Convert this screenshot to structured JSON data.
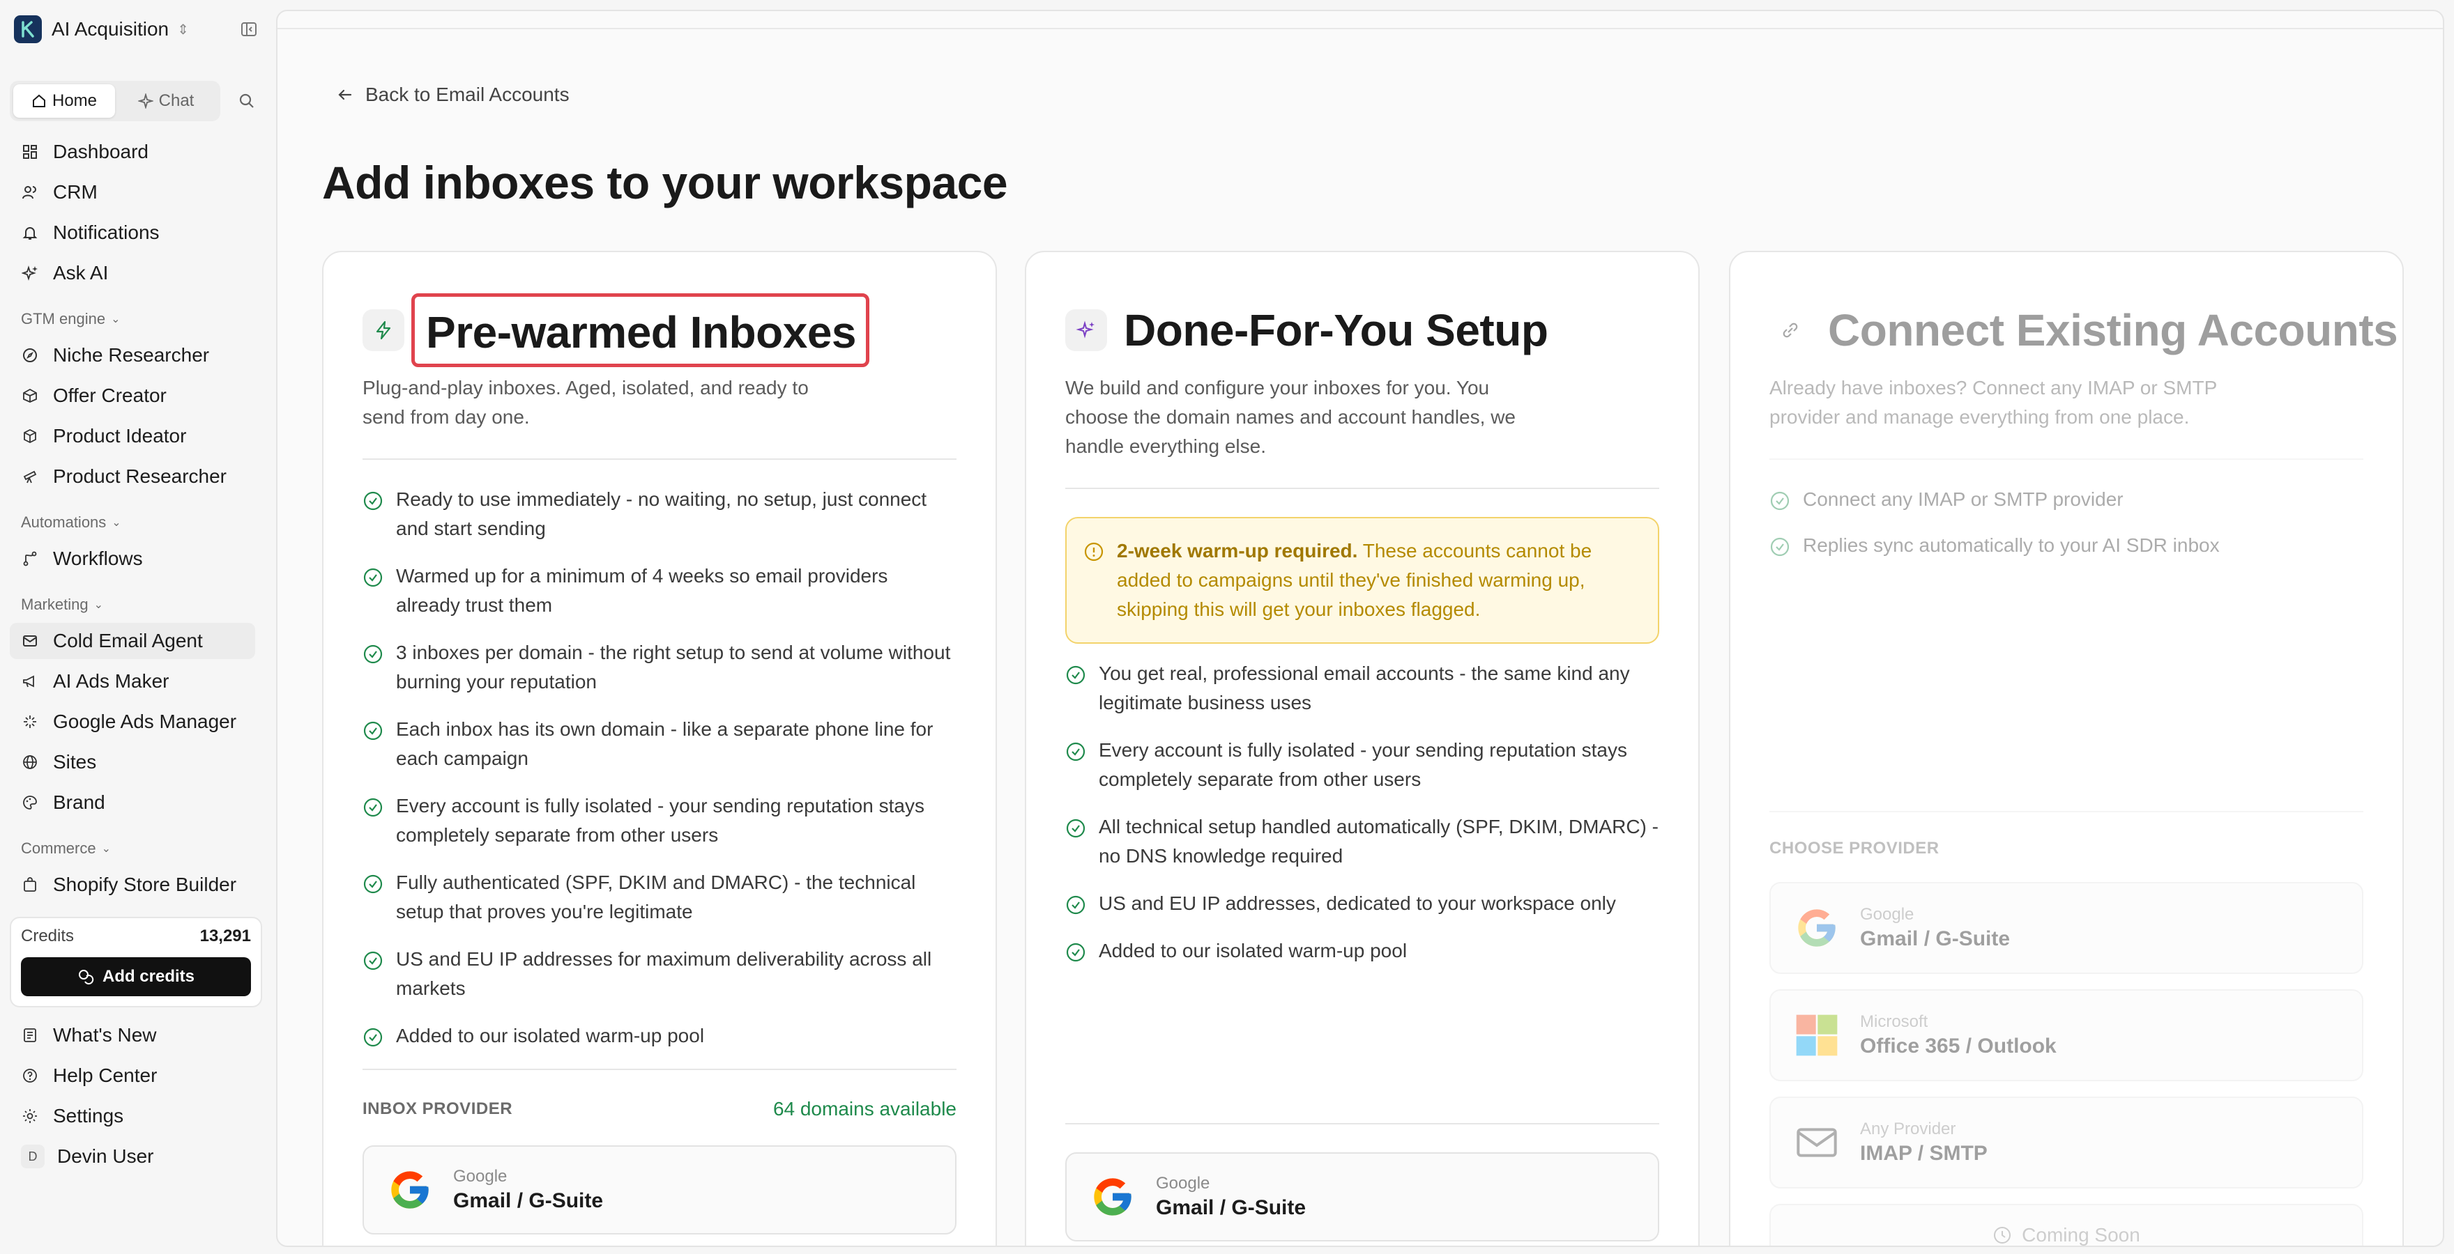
{
  "workspace": {
    "name": "AI Acquisition"
  },
  "tabs": {
    "home": "Home",
    "chat": "Chat"
  },
  "nav_main": [
    {
      "label": "Dashboard",
      "icon": "dashboard-icon"
    },
    {
      "label": "CRM",
      "icon": "users-icon"
    },
    {
      "label": "Notifications",
      "icon": "bell-icon"
    },
    {
      "label": "Ask AI",
      "icon": "sparkles-icon"
    }
  ],
  "sections": {
    "gtm": "GTM engine",
    "automations": "Automations",
    "marketing": "Marketing",
    "commerce": "Commerce"
  },
  "nav_gtm": [
    {
      "label": "Niche Researcher",
      "icon": "compass-icon"
    },
    {
      "label": "Offer Creator",
      "icon": "box-icon"
    },
    {
      "label": "Product Ideator",
      "icon": "cube-icon"
    },
    {
      "label": "Product Researcher",
      "icon": "telescope-icon"
    }
  ],
  "nav_automations": [
    {
      "label": "Workflows",
      "icon": "workflow-icon"
    }
  ],
  "nav_marketing": [
    {
      "label": "Cold Email Agent",
      "icon": "mail-icon",
      "active": true
    },
    {
      "label": "AI Ads Maker",
      "icon": "megaphone-icon"
    },
    {
      "label": "Google Ads Manager",
      "icon": "sparkle-icon"
    },
    {
      "label": "Sites",
      "icon": "globe-icon"
    },
    {
      "label": "Brand",
      "icon": "palette-icon"
    }
  ],
  "nav_commerce": [
    {
      "label": "Shopify Store Builder",
      "icon": "store-icon"
    }
  ],
  "credits": {
    "label": "Credits",
    "value": "13,291",
    "button": "Add credits"
  },
  "nav_bottom": [
    {
      "label": "What's New",
      "icon": "news-icon"
    },
    {
      "label": "Help Center",
      "icon": "help-icon"
    },
    {
      "label": "Settings",
      "icon": "gear-icon"
    }
  ],
  "user": {
    "name": "Devin User",
    "initial": "D"
  },
  "main": {
    "back": "Back to Email Accounts",
    "title": "Add inboxes to your workspace"
  },
  "cards": {
    "prewarmed": {
      "title": "Pre-warmed Inboxes",
      "desc": "Plug-and-play inboxes. Aged, isolated, and ready to send from day one.",
      "features": [
        "Ready to use immediately - no waiting, no setup, just connect and start sending",
        "Warmed up for a minimum of 4 weeks so email providers already trust them",
        "3 inboxes per domain - the right setup to send at volume without burning your reputation",
        "Each inbox has its own domain - like a separate phone line for each campaign",
        "Every account is fully isolated - your sending reputation stays completely separate from other users",
        "Fully authenticated (SPF, DKIM and DMARC) - the technical setup that proves you're legitimate",
        "US and EU IP addresses for maximum deliverability across all markets",
        "Added to our isolated warm-up pool"
      ],
      "provider_label": "INBOX PROVIDER",
      "available": "64 domains available",
      "provider": {
        "sub": "Google",
        "name": "Gmail / G-Suite"
      }
    },
    "dfy": {
      "title": "Done-For-You Setup",
      "desc": "We build and configure your inboxes for you. You choose the domain names and account handles, we handle everything else.",
      "warning_bold": "2-week warm-up required.",
      "warning_text": " These accounts cannot be added to campaigns until they've finished warming up, skipping this will get your inboxes flagged.",
      "features": [
        "You get real, professional email accounts - the same kind any legitimate business uses",
        "Every account is fully isolated - your sending reputation stays completely separate from other users",
        "All technical setup handled automatically (SPF, DKIM, DMARC) - no DNS knowledge required",
        "US and EU IP addresses, dedicated to your workspace only",
        "Added to our isolated warm-up pool"
      ],
      "provider": {
        "sub": "Google",
        "name": "Gmail / G-Suite"
      }
    },
    "connect": {
      "title": "Connect Existing Accounts",
      "desc": "Already have inboxes? Connect any IMAP or SMTP provider and manage everything from one place.",
      "features": [
        "Connect any IMAP or SMTP provider",
        "Replies sync automatically to your AI SDR inbox"
      ],
      "choose_label": "CHOOSE PROVIDER",
      "providers": [
        {
          "sub": "Google",
          "name": "Gmail / G-Suite"
        },
        {
          "sub": "Microsoft",
          "name": "Office 365 / Outlook"
        },
        {
          "sub": "Any Provider",
          "name": "IMAP / SMTP"
        }
      ],
      "coming_soon": "Coming Soon"
    }
  },
  "colors": {
    "accent_green": "#1f8a4c",
    "highlight_red": "#e0434d",
    "warning_bg": "#fff9e3"
  }
}
